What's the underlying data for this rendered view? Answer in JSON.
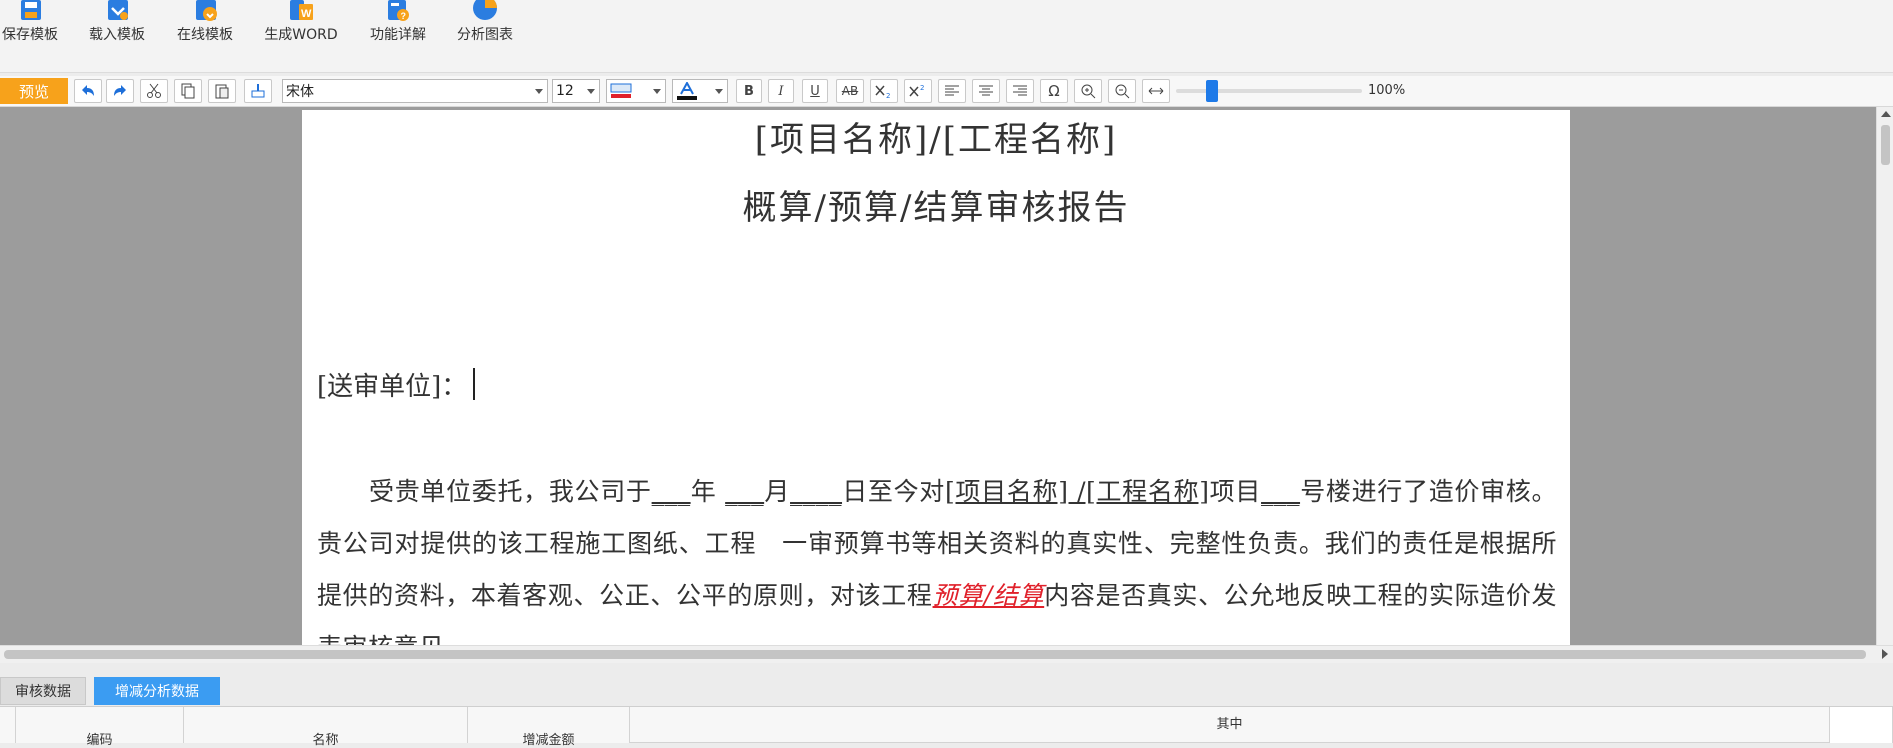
{
  "ribbon": {
    "items": [
      {
        "label": "保存模板",
        "icon": "save-template-icon"
      },
      {
        "label": "载入模板",
        "icon": "load-template-icon"
      },
      {
        "label": "在线模板",
        "icon": "online-template-icon"
      },
      {
        "label": "生成WORD",
        "icon": "word-icon"
      },
      {
        "label": "功能详解",
        "icon": "help-doc-icon"
      },
      {
        "label": "分析图表",
        "icon": "pie-chart-icon"
      }
    ]
  },
  "toolbar": {
    "preview_label": "预览",
    "font_family": "宋体",
    "font_size": "12",
    "zoom_percent": 100,
    "zoom_label": "100%",
    "accent_color": "#f7a21b",
    "slider_color": "#1e7ae8"
  },
  "document": {
    "title_line1": "[项目名称]/[工程名称]",
    "title_line2": "概算/预算/结算审核报告",
    "submit_unit_label": "[送审单位]：",
    "paragraph": {
      "p1": "受贵单位委托，我公司于",
      "blank1": "___",
      "year": "年",
      "blank2": "___",
      "month": "月",
      "blank3": "____",
      "p2": "日至今对",
      "project_ref": "[项目名称] /[工程名称]",
      "p3": "项目",
      "blank4": "___",
      "p4": "号楼进行了造价审核。贵公司对提供的该工程施工图纸、工程　一审预算书等相关资料的真实性、完整性负责。我们的责任是根据所提供的资料，本着客观、公正、公平的原则，对该工程",
      "highlight": "预算/结算",
      "p5": "内容是否真实、公允地反映工程的实际造价发表审核意见。"
    }
  },
  "bottom_tabs": [
    {
      "label": "审核数据",
      "active": false
    },
    {
      "label": "增减分析数据",
      "active": true
    }
  ],
  "grid": {
    "headers": [
      "编码",
      "名称",
      "增减金额"
    ],
    "group_header": "其中"
  }
}
